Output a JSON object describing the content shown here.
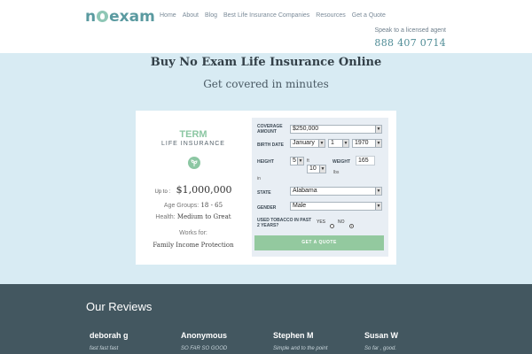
{
  "header": {
    "logo_left": "n",
    "logo_right": "exam",
    "nav": [
      "Home",
      "About",
      "Blog",
      "Best Life Insurance Companies",
      "Resources",
      "Get a Quote"
    ],
    "agent_label": "Speak to a licensed agent",
    "phone": "888 407 0714"
  },
  "hero": {
    "title": "Buy No Exam Life Insurance Online",
    "subtitle": "Get covered in minutes"
  },
  "product": {
    "term": "TERM",
    "life_insurance": "LIFE INSURANCE",
    "up_to_label": "Up to",
    "amount": "$1,000,000",
    "age_label": "Age Groups:",
    "age_value": "18 - 65",
    "health_label": "Health:",
    "health_value": "Medium to Great",
    "works_label": "Works for:",
    "works_value": "Family Income Protection"
  },
  "form": {
    "coverage_label": "COVERAGE AMOUNT",
    "coverage_value": "$250,000",
    "birth_label": "BIRTH DATE",
    "birth_month": "January",
    "birth_day": "1",
    "birth_year": "1970",
    "height_label": "HEIGHT",
    "height_ft": "5",
    "ft_label": "ft",
    "height_in": "10",
    "in_label": "in",
    "weight_label": "WEIGHT",
    "weight_value": "165",
    "lbs_label": "lbs",
    "state_label": "STATE",
    "state_value": "Alabama",
    "gender_label": "GENDER",
    "gender_value": "Male",
    "tobacco_label": "USED TOBACCO IN PAST 2 YEARS?",
    "yes_label": "YES",
    "no_label": "NO",
    "tobacco_selected": "no",
    "button_label": "GET A QUOTE",
    "arrow": "▼"
  },
  "reviews": {
    "title": "Our Reviews",
    "items": [
      {
        "name": "deborah g",
        "text": "fast fast fast"
      },
      {
        "name": "Anonymous",
        "text": "SO FAR SO GOOD"
      },
      {
        "name": "Stephen M",
        "text": "Simple and to the point"
      },
      {
        "name": "Susan W",
        "text": "So far , good."
      }
    ]
  },
  "colors": {
    "accent_green": "#93c99f",
    "brand_teal": "#5a9aa0",
    "hero_bg": "#d8ebf3",
    "reviews_bg": "#435760"
  }
}
